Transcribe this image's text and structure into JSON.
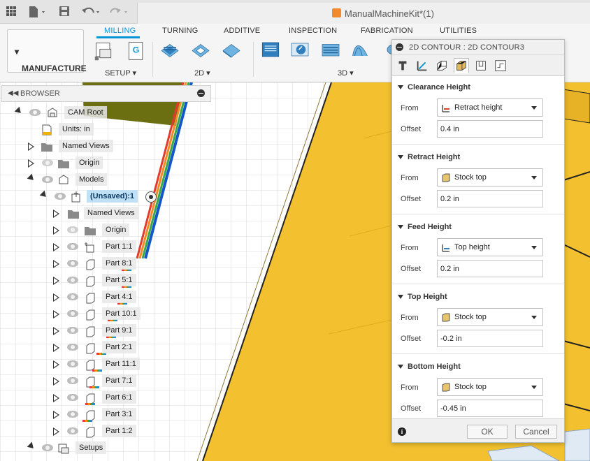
{
  "document": {
    "title": "ManualMachineKit*(1)"
  },
  "ribbon": {
    "workspace": "MANUFACTURE",
    "tabs": [
      {
        "label": "MILLING",
        "active": true
      },
      {
        "label": "TURNING"
      },
      {
        "label": "ADDITIVE"
      },
      {
        "label": "INSPECTION"
      },
      {
        "label": "FABRICATION"
      },
      {
        "label": "UTILITIES"
      }
    ],
    "groups": {
      "setup": "SETUP",
      "g2d": "2D",
      "g3d": "3D"
    },
    "accent": "#0696d7"
  },
  "browser": {
    "title": "BROWSER",
    "items": [
      {
        "label": "CAM Root"
      },
      {
        "label": "Units: in"
      },
      {
        "label": "Named Views"
      },
      {
        "label": "Origin"
      },
      {
        "label": "Models"
      },
      {
        "label": "(Unsaved):1"
      },
      {
        "label": "Named Views"
      },
      {
        "label": "Origin"
      },
      {
        "label": "Part 1:1"
      },
      {
        "label": "Part 8:1"
      },
      {
        "label": "Part 5:1"
      },
      {
        "label": "Part 4:1"
      },
      {
        "label": "Part 10:1"
      },
      {
        "label": "Part 9:1"
      },
      {
        "label": "Part 2:1"
      },
      {
        "label": "Part 11:1"
      },
      {
        "label": "Part 7:1"
      },
      {
        "label": "Part 6:1"
      },
      {
        "label": "Part 3:1"
      },
      {
        "label": "Part 1:2"
      },
      {
        "label": "Setups"
      }
    ]
  },
  "dialog": {
    "title": "2D CONTOUR : 2D CONTOUR3",
    "from_label": "From",
    "offset_label": "Offset",
    "sections": [
      {
        "title": "Clearance Height",
        "from": "Retract height",
        "offset": "0.4 in"
      },
      {
        "title": "Retract Height",
        "from": "Stock top",
        "offset": "0.2 in"
      },
      {
        "title": "Feed Height",
        "from": "Top height",
        "offset": "0.2 in"
      },
      {
        "title": "Top Height",
        "from": "Stock top",
        "offset": "-0.2 in"
      },
      {
        "title": "Bottom Height",
        "from": "Stock top",
        "offset": "-0.45 in"
      }
    ],
    "ok": "OK",
    "cancel": "Cancel"
  }
}
